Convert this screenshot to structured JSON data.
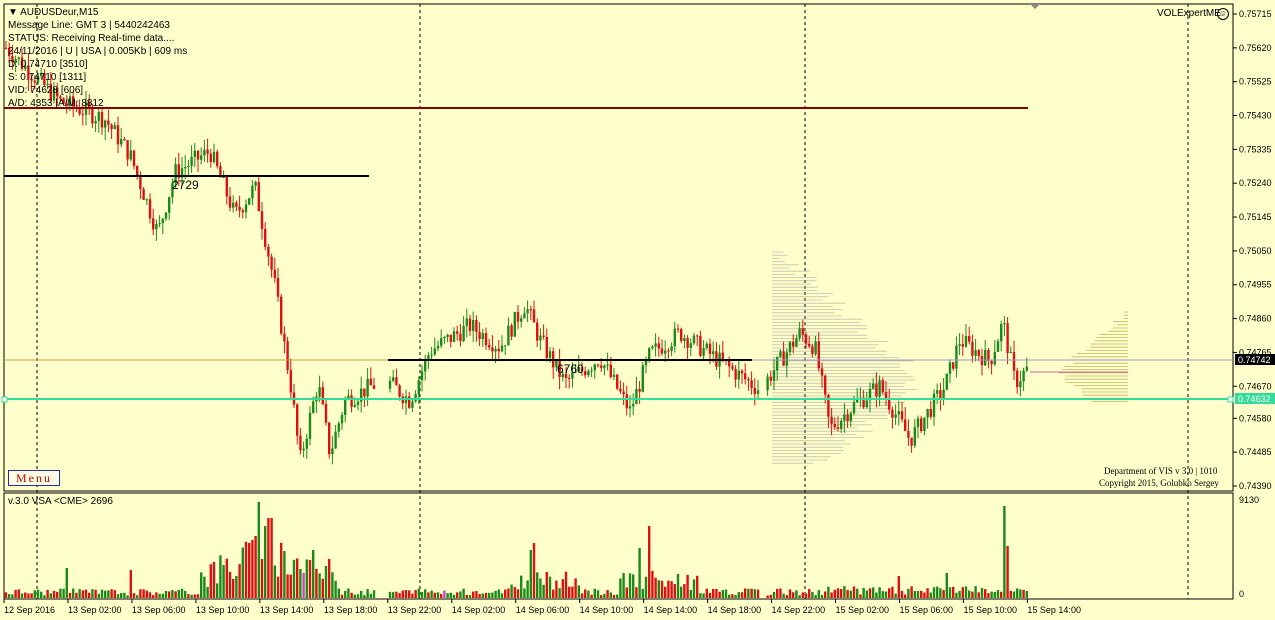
{
  "header": {
    "symbol_title": "AUDUSDeur,M15",
    "message_line": "Message Line: GMT 3 | 5440242463",
    "status_line": "STATUS:  Receiving Real-time data....",
    "date_line": "24/11/2016 | U | USA | 0.005Kb | 609 ms",
    "d_line": "D: 0.74710  [3510]",
    "s_line": "S: 0.74710  [1311]",
    "vid_line": "VID: 74628  [606]",
    "ad_line": "A/D: 4353  [A/M: 8812"
  },
  "menu_label": "Menu",
  "ea_label": "VOLExpertME",
  "ea_icon": "smiley-icon",
  "copyright": {
    "line1": "Department of VIS  v 3.0 | 1010",
    "line2": "Copyright 2015, Golubko Sergey"
  },
  "indicator_title": "v.3.0 VSA  <CME> 2696",
  "volume_axis": {
    "top": "9130",
    "bottom": "0"
  },
  "price_axis": [
    "0.75715",
    "0.75620",
    "0.75525",
    "0.75430",
    "0.75335",
    "0.75240",
    "0.75145",
    "0.75050",
    "0.74955",
    "0.74860",
    "0.74765",
    "0.74670",
    "0.74580",
    "0.74485",
    "0.74390"
  ],
  "current_price": "0.74742",
  "line_price": "0.74632",
  "levels": {
    "level1": "2729",
    "level2": "6760"
  },
  "time_labels": [
    "12 Sep 2016",
    "13 Sep 02:00",
    "13 Sep 06:00",
    "13 Sep 10:00",
    "13 Sep 14:00",
    "13 Sep 18:00",
    "13 Sep 22:00",
    "14 Sep 02:00",
    "14 Sep 06:00",
    "14 Sep 10:00",
    "14 Sep 14:00",
    "14 Sep 18:00",
    "14 Sep 22:00",
    "15 Sep 02:00",
    "15 Sep 06:00",
    "15 Sep 10:00",
    "15 Sep 14:00"
  ],
  "colors": {
    "background": "#ffffcc",
    "bull": "#1a8a1a",
    "bear": "#dd1111",
    "cyan_line": "#33dd99",
    "dark_red_line": "#8b0000"
  }
}
